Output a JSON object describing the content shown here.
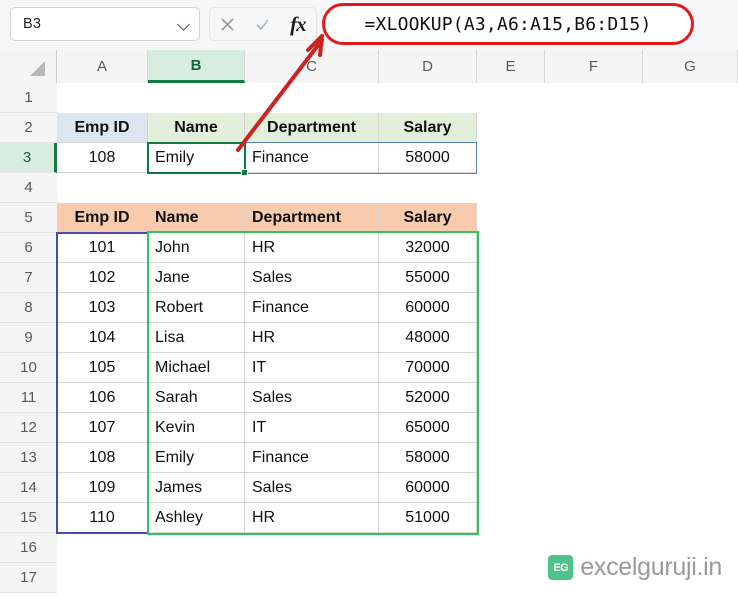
{
  "formula_bar": {
    "name_box_value": "B3",
    "cancel_icon": "close-icon",
    "enter_icon": "check-icon",
    "function_icon": "fx-icon",
    "formula": "=XLOOKUP(A3,A6:A15,B6:D15)",
    "highlight_color": "#e01b1b"
  },
  "grid": {
    "columns": [
      "A",
      "B",
      "C",
      "D",
      "E",
      "F",
      "G"
    ],
    "active_column": "B",
    "active_row": "3",
    "active_cell": "B3",
    "rows": [
      "1",
      "2",
      "3",
      "4",
      "5",
      "6",
      "7",
      "8",
      "9",
      "10",
      "11",
      "12",
      "13",
      "14",
      "15",
      "16",
      "17"
    ]
  },
  "result_table": {
    "headers": [
      "Emp ID",
      "Name",
      "Department",
      "Salary"
    ],
    "header_fill_a": "#dce6f1",
    "header_fill_bcd": "#e2efda",
    "row": [
      "108",
      "Emily",
      "Finance",
      "58000"
    ]
  },
  "lookup_table": {
    "headers": [
      "Emp ID",
      "Name",
      "Department",
      "Salary"
    ],
    "header_fill": "#f8cbad",
    "rows": [
      [
        "101",
        "John",
        "HR",
        "32000"
      ],
      [
        "102",
        "Jane",
        "Sales",
        "55000"
      ],
      [
        "103",
        "Robert",
        "Finance",
        "60000"
      ],
      [
        "104",
        "Lisa",
        "HR",
        "48000"
      ],
      [
        "105",
        "Michael",
        "IT",
        "70000"
      ],
      [
        "106",
        "Sarah",
        "Sales",
        "52000"
      ],
      [
        "107",
        "Kevin",
        "IT",
        "65000"
      ],
      [
        "108",
        "Emily",
        "Finance",
        "58000"
      ],
      [
        "109",
        "James",
        "Sales",
        "60000"
      ],
      [
        "110",
        "Ashley",
        "HR",
        "51000"
      ]
    ],
    "lookup_array_border_color": "#4a4ab5",
    "return_array_border_color": "#2ec45f"
  },
  "annotation": {
    "arrow_color": "#cc2222",
    "arrow_name": "formula-callout-arrow"
  },
  "watermark": {
    "logo_text": "EG",
    "site": "excelguruji.in"
  }
}
